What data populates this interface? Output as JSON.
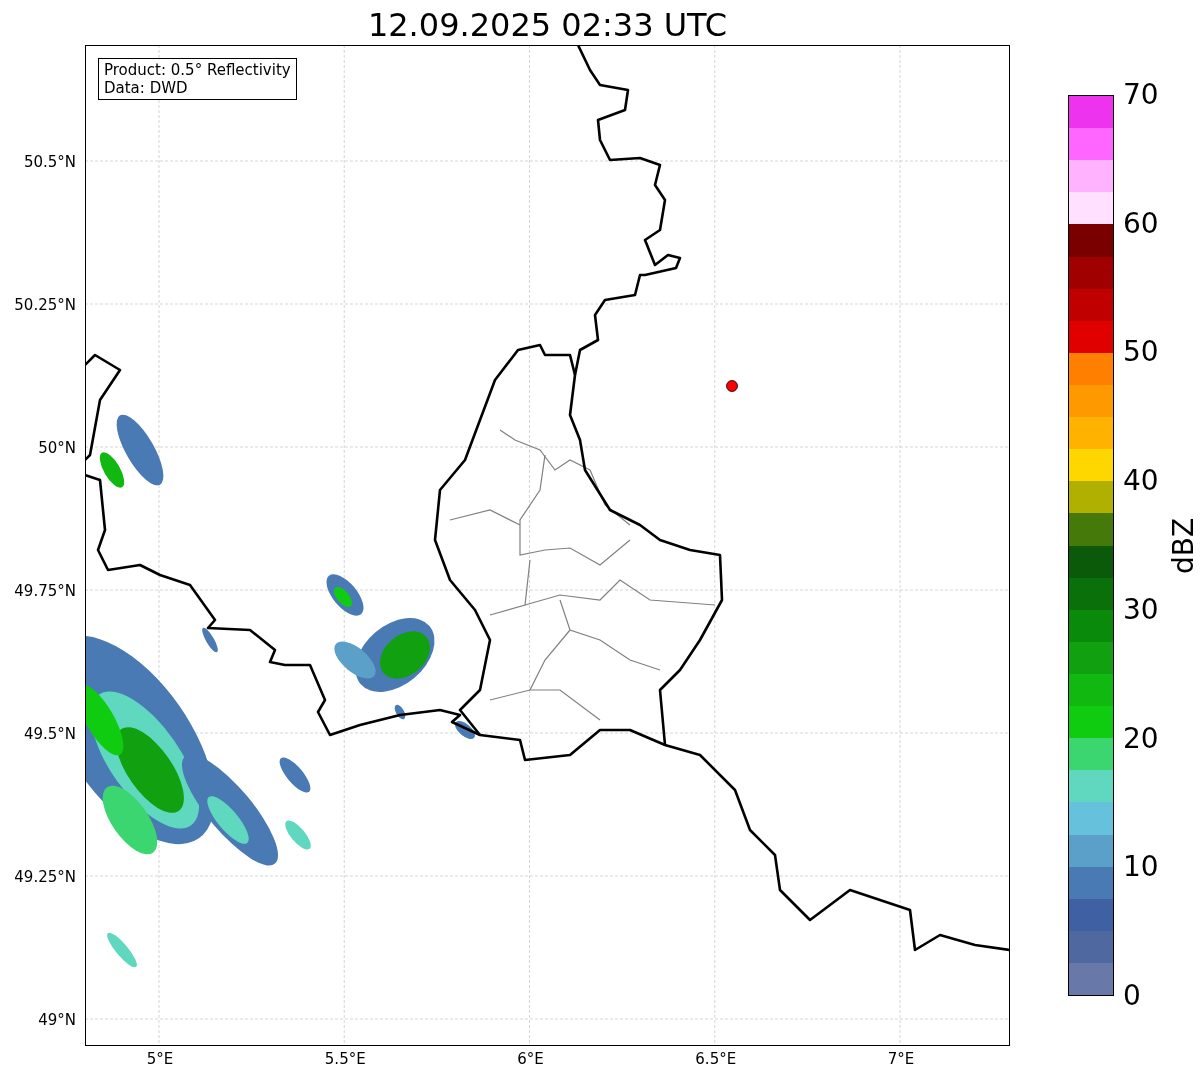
{
  "title": "12.09.2025 02:33 UTC",
  "info_box": [
    "Product: 0.5° Reflectivity",
    "Data: DWD"
  ],
  "y_ticks": [
    "50.5°N",
    "50.25°N",
    "50°N",
    "49.75°N",
    "49.5°N",
    "49.25°N",
    "49°N"
  ],
  "x_ticks": [
    "5°E",
    "5.5°E",
    "6°E",
    "6.5°E",
    "7°E"
  ],
  "colorbar": {
    "label": "dBZ",
    "ticks": [
      "70",
      "60",
      "50",
      "40",
      "30",
      "20",
      "10",
      "0"
    ],
    "segments": [
      {
        "color": "#ee33ee"
      },
      {
        "color": "#ff66ff"
      },
      {
        "color": "#ffb3ff"
      },
      {
        "color": "#ffe0ff"
      },
      {
        "color": "#7a0000"
      },
      {
        "color": "#a00000"
      },
      {
        "color": "#c00000"
      },
      {
        "color": "#e00000"
      },
      {
        "color": "#ff8000"
      },
      {
        "color": "#ff9900"
      },
      {
        "color": "#ffb300"
      },
      {
        "color": "#ffd700"
      },
      {
        "color": "#b0b000"
      },
      {
        "color": "#457a0a"
      },
      {
        "color": "#0a5a0a"
      },
      {
        "color": "#0a700a"
      },
      {
        "color": "#0a8a0a"
      },
      {
        "color": "#10a010"
      },
      {
        "color": "#10b810"
      },
      {
        "color": "#10cc10"
      },
      {
        "color": "#3cd670"
      },
      {
        "color": "#60d8c0"
      },
      {
        "color": "#66c2dc"
      },
      {
        "color": "#5aa0c8"
      },
      {
        "color": "#4a7ab4"
      },
      {
        "color": "#4060a4"
      },
      {
        "color": "#5068a0"
      },
      {
        "color": "#6878a8"
      }
    ]
  }
}
